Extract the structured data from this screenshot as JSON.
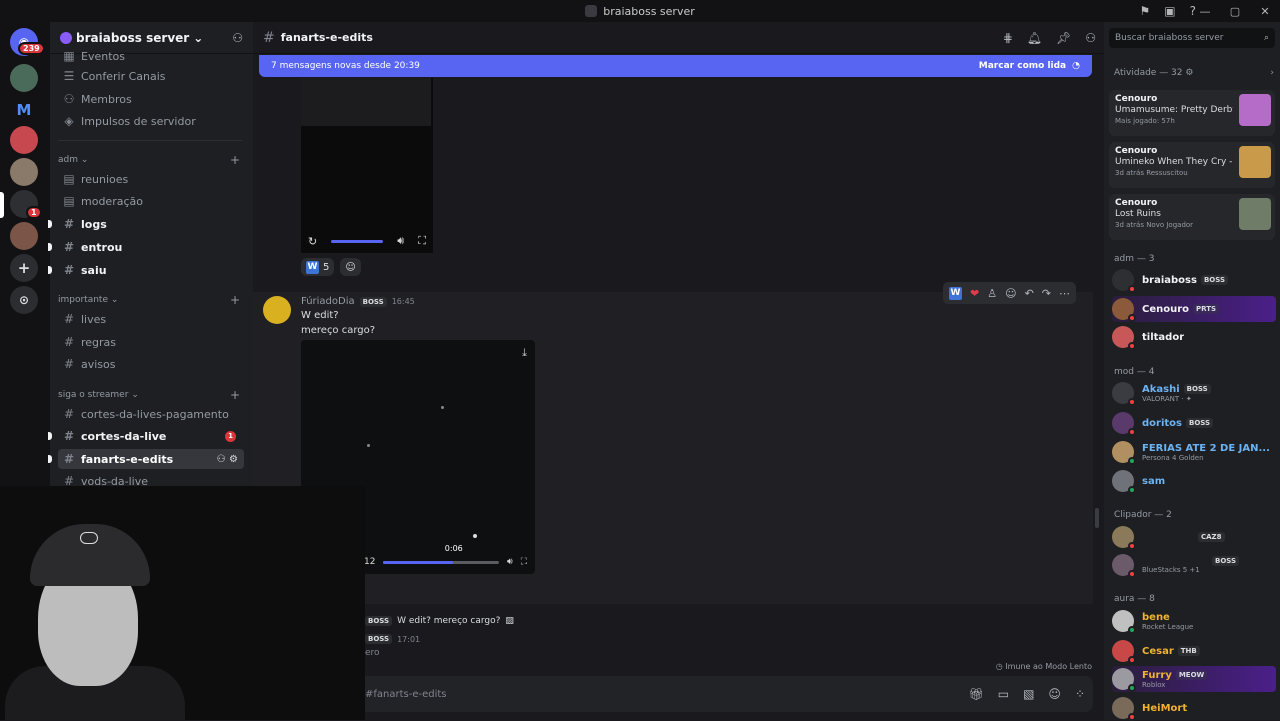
{
  "window": {
    "title": "braiaboss server"
  },
  "rail": {
    "mention_count": "239",
    "server_badge": "1",
    "m_letter": "M"
  },
  "sidebar": {
    "server_name": "braiaboss server",
    "top_items": [
      "Eventos",
      "Conferir Canais",
      "Membros",
      "Impulsos de servidor"
    ],
    "cat_adm": "adm",
    "adm_channels": [
      "reunioes",
      "moderação",
      "logs",
      "entrou",
      "saiu"
    ],
    "cat_importante": "importante",
    "imp_channels": [
      "lives",
      "regras",
      "avisos"
    ],
    "cat_siga": "siga o streamer",
    "siga_channels": [
      "cortes-da-lives-pagamento",
      "cortes-da-live",
      "fanarts-e-edits",
      "vods-da-live"
    ],
    "cortes_badge": "1"
  },
  "channel": {
    "name": "fanarts-e-edits",
    "new_messages": "7 mensagens novas desde 20:39",
    "mark_read": "Marcar como lida"
  },
  "messages": {
    "reaction_count": "5",
    "author": "FúriadoDia",
    "author_tag": "BOSS",
    "time": "16:45",
    "line1": "W edit?",
    "line2": "mereço cargo?",
    "video_time": ":12",
    "video_tooltip": "0:06",
    "reply_tag": "BOSS",
    "reply_text": "W edit? mereço cargo?",
    "reply2_tag": "BOSS",
    "reply2_time": "17:01",
    "reply3_text": "ero",
    "slow_mode": "Imune ao Modo Lento",
    "input_placeholder": "#fanarts-e-edits"
  },
  "video": {
    "progress": 0.6
  },
  "members": {
    "search_placeholder": "Buscar braiaboss server",
    "activity_head": "Atividade — 32",
    "activity": [
      {
        "who": "Cenouro",
        "game": "Umamusume: Pretty Derby",
        "sub": "Mais jogado: 57h"
      },
      {
        "who": "Cenouro",
        "game": "Umineko When They Cry - ...",
        "sub": "3d atrás   Ressuscitou"
      },
      {
        "who": "Cenouro",
        "game": "Lost Ruins",
        "sub": "3d atrás   Novo Jogador"
      }
    ],
    "adm_head": "adm — 3",
    "adm": [
      {
        "name": "braiaboss",
        "tag": "BOSS"
      },
      {
        "name": "Cenouro",
        "tag": "PRTS"
      },
      {
        "name": "tiltador"
      }
    ],
    "mod_head": "mod — 4",
    "mod": [
      {
        "name": "Akashi",
        "tag": "BOSS",
        "status": "VALORANT · ✦"
      },
      {
        "name": "doritos",
        "tag": "BOSS"
      },
      {
        "name": "FERIAS ATE 2 DE JAN...",
        "status": "Persona 4 Golden"
      },
      {
        "name": "sam"
      }
    ],
    "clip_head": "Clipador — 2",
    "clip": [
      {
        "name": "",
        "tag": "CAZ8"
      },
      {
        "name": "",
        "tag": "BOSS",
        "status": "BlueStacks 5 +1"
      }
    ],
    "aura_head": "aura — 8",
    "aura": [
      {
        "name": "bene",
        "status": "Rocket League"
      },
      {
        "name": "Cesar",
        "tag": "THB"
      },
      {
        "name": "Furry",
        "tag": "MEOW",
        "status": "Roblox"
      },
      {
        "name": "HeiMort"
      }
    ]
  },
  "colors": {
    "accent": "#5865f2",
    "danger": "#da373c",
    "online": "#23a55a",
    "dnd": "#f23f43"
  }
}
